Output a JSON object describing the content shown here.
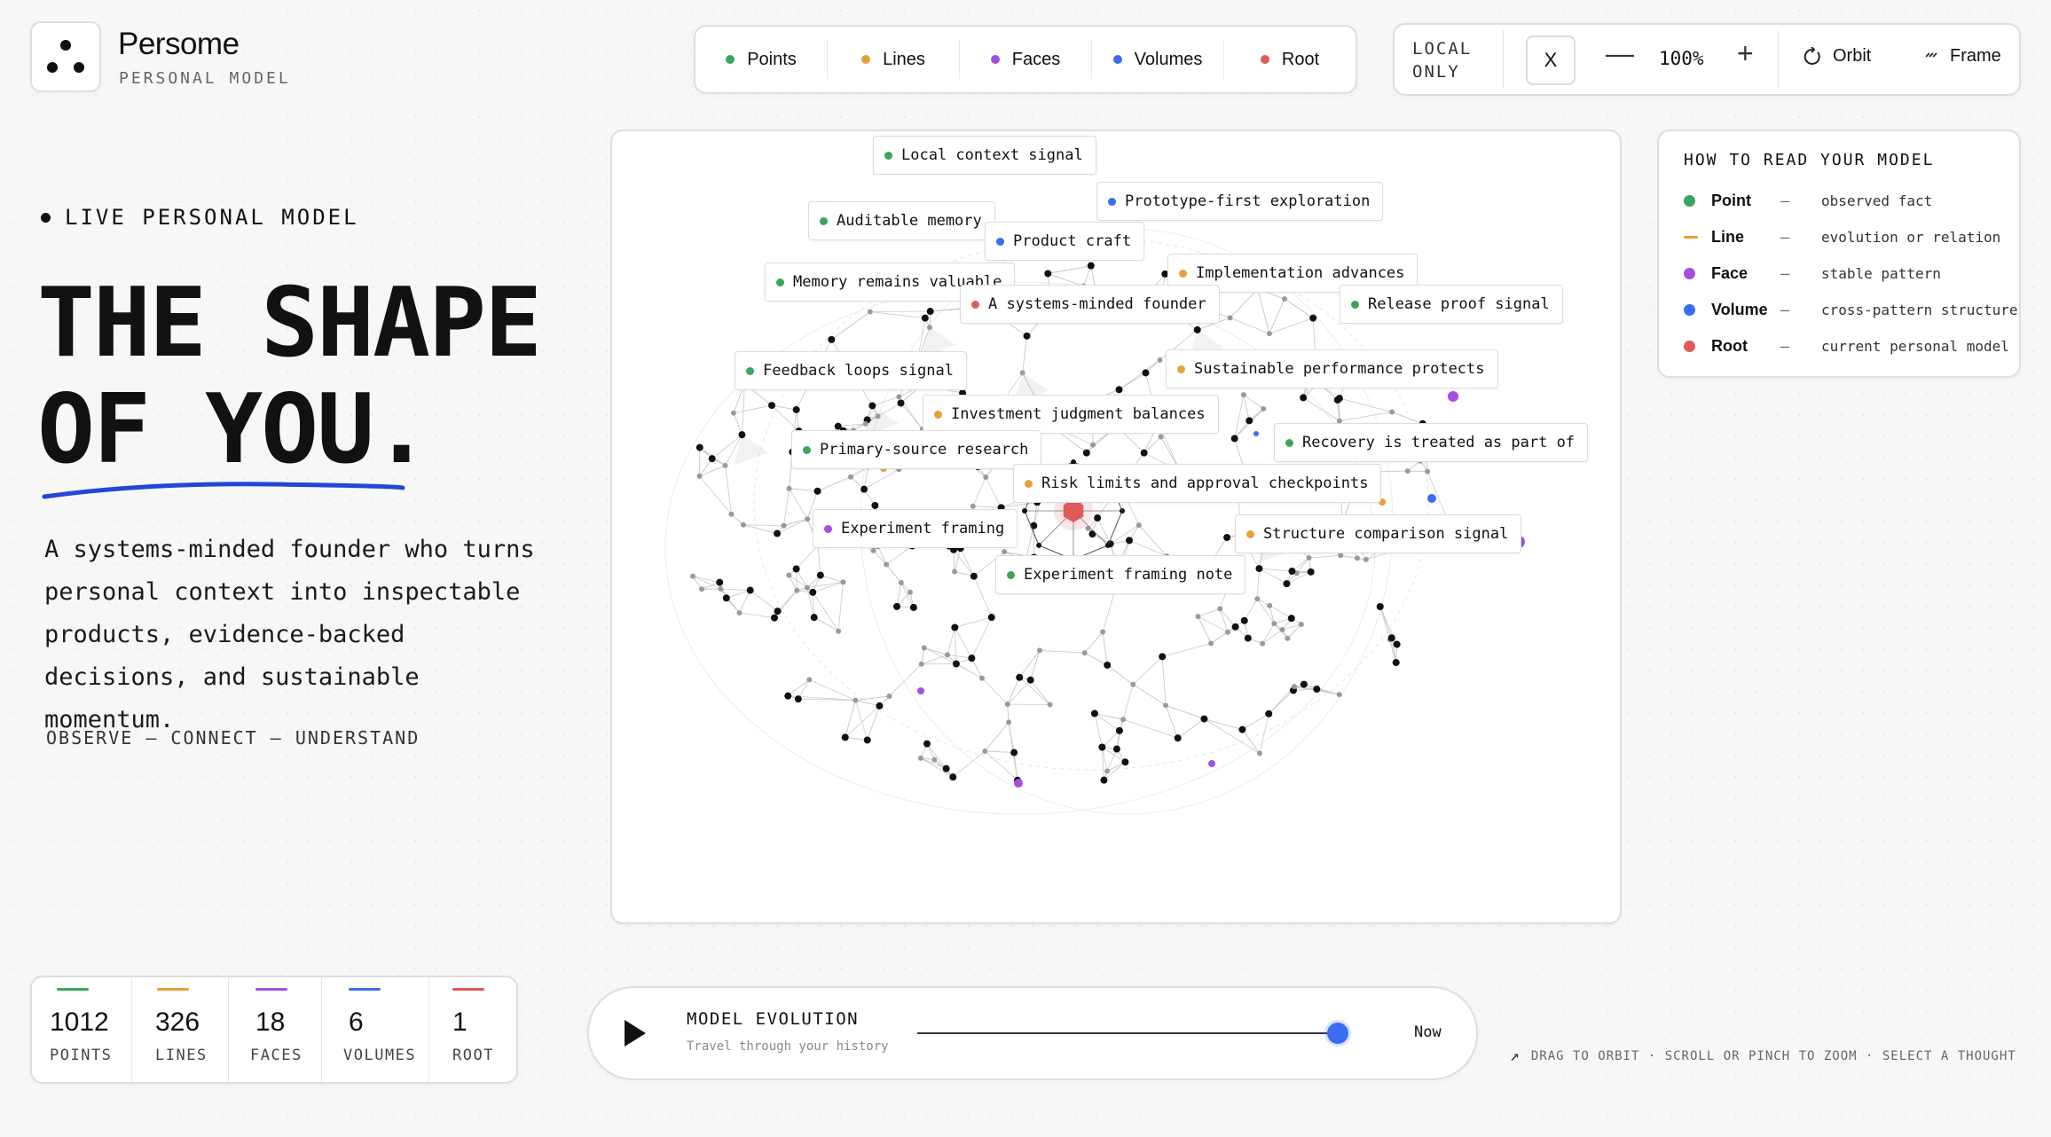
{
  "brand": {
    "name": "Persome",
    "subtitle": "PERSONAL MODEL"
  },
  "filters": [
    {
      "label": "Points",
      "color": "#3ba55c"
    },
    {
      "label": "Lines",
      "color": "#e8a03a"
    },
    {
      "label": "Faces",
      "color": "#a64ee0"
    },
    {
      "label": "Volumes",
      "color": "#3a6df0"
    },
    {
      "label": "Root",
      "color": "#e05a5a"
    }
  ],
  "controls": {
    "local_line1": "LOCAL",
    "local_line2": "ONLY",
    "x_label": "X",
    "zoom_out": "—",
    "zoom_level": "100%",
    "zoom_in": "+",
    "orbit_label": "Orbit",
    "frame_label": "Frame"
  },
  "hero": {
    "live_label": "LIVE PERSONAL MODEL",
    "title_line1": "THE SHAPE",
    "title_line2": "OF YOU.",
    "description": "A systems-minded founder who turns personal context into inspectable products, evidence-backed decisions, and sustainable momentum.",
    "motto": "OBSERVE — CONNECT — UNDERSTAND"
  },
  "graph_labels": [
    {
      "text": "Local context signal",
      "color": "#3ba55c"
    },
    {
      "text": "Prototype-first exploration",
      "color": "#3a6df0"
    },
    {
      "text": "Auditable memory",
      "color": "#3ba55c"
    },
    {
      "text": "Product craft",
      "color": "#3a6df0"
    },
    {
      "text": "Implementation advances",
      "color": "#e8a03a"
    },
    {
      "text": "Memory remains valuable",
      "color": "#3ba55c"
    },
    {
      "text": "A systems-minded founder",
      "color": "#e05a5a"
    },
    {
      "text": "Release proof signal",
      "color": "#3ba55c"
    },
    {
      "text": "Feedback loops signal",
      "color": "#3ba55c"
    },
    {
      "text": "Sustainable performance protects",
      "color": "#e8a03a"
    },
    {
      "text": "Investment judgment balances",
      "color": "#e8a03a"
    },
    {
      "text": "Recovery is treated as part of",
      "color": "#3ba55c"
    },
    {
      "text": "Primary-source research",
      "color": "#3ba55c"
    },
    {
      "text": "Risk limits and approval checkpoints",
      "color": "#e8a03a"
    },
    {
      "text": "Experiment framing",
      "color": "#a64ee0"
    },
    {
      "text": "Structure comparison signal",
      "color": "#e8a03a"
    },
    {
      "text": "Experiment framing note",
      "color": "#3ba55c"
    }
  ],
  "legend": {
    "title": "HOW TO READ YOUR MODEL",
    "rows": [
      {
        "name": "Point",
        "desc": "observed fact",
        "color": "#3ba55c"
      },
      {
        "name": "Line",
        "desc": "evolution or relation",
        "color": "#e8a03a"
      },
      {
        "name": "Face",
        "desc": "stable pattern",
        "color": "#a64ee0"
      },
      {
        "name": "Volume",
        "desc": "cross-pattern structure",
        "color": "#3a6df0"
      },
      {
        "name": "Root",
        "desc": "current personal model",
        "color": "#e05a5a"
      }
    ],
    "dash": "—"
  },
  "stats": [
    {
      "value": "1012",
      "label": "POINTS",
      "color": "#3ba55c"
    },
    {
      "value": "326",
      "label": "LINES",
      "color": "#e8a03a"
    },
    {
      "value": "18",
      "label": "FACES",
      "color": "#a64ee0"
    },
    {
      "value": "6",
      "label": "VOLUMES",
      "color": "#3a6df0"
    },
    {
      "value": "1",
      "label": "ROOT",
      "color": "#e05a5a"
    }
  ],
  "evolution": {
    "title": "MODEL EVOLUTION",
    "subtitle": "Travel through your history",
    "position": 1.0,
    "end_label": "Now"
  },
  "hint": "DRAG TO ORBIT · SCROLL OR PINCH TO ZOOM · SELECT A THOUGHT"
}
